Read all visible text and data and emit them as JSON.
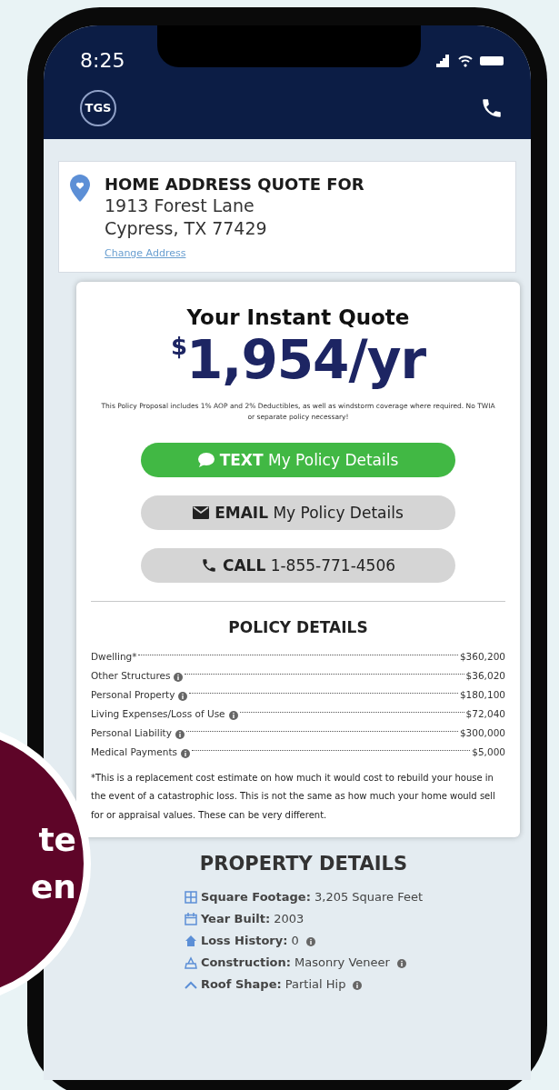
{
  "status_bar": {
    "time": "8:25"
  },
  "header": {
    "logo": "TGS"
  },
  "address_card": {
    "heading": "HOME ADDRESS QUOTE FOR",
    "line_1": "1913 Forest Lane",
    "line_2": "Cypress, TX 77429",
    "change_link": "Change Address"
  },
  "quote": {
    "title": "Your Instant Quote",
    "currency": "$",
    "amount": "1,954/yr",
    "disclaimer": "This Policy Proposal includes 1% AOP and 2% Deductibles, as well as windstorm coverage where required. No TWIA or separate policy necessary!",
    "buttons": [
      {
        "kind": "text",
        "label": "**TEXT** My Policy Details"
      },
      {
        "kind": "email",
        "label": "**EMAIL** My Policy Details"
      },
      {
        "kind": "call",
        "label": "**CALL** 1-855-771-4506"
      }
    ]
  },
  "policy_details": {
    "title": "POLICY DETAILS",
    "rows": [
      {
        "label": "Dwelling*",
        "info": false,
        "value": "$360,200"
      },
      {
        "label": "Other Structures",
        "info": true,
        "value": "$36,020"
      },
      {
        "label": "Personal Property",
        "info": true,
        "value": "$180,100"
      },
      {
        "label": "Living Expenses/Loss of Use",
        "info": true,
        "value": "$72,040"
      },
      {
        "label": "Personal Liability",
        "info": true,
        "value": "$300,000"
      },
      {
        "label": "Medical Payments",
        "info": true,
        "value": "$5,000"
      }
    ],
    "note": "*This is a replacement cost estimate on how much it would cost to rebuild your house in the event of a catastrophic loss. This is not the same as how much your home would sell for or appraisal values. These can be very different."
  },
  "property_details": {
    "title": "PROPERTY DETAILS",
    "items": [
      {
        "kind": "area",
        "label": "Square Footage:",
        "value": "3,205 Square Feet",
        "info": false
      },
      {
        "kind": "year",
        "label": "Year Built:",
        "value": "2003",
        "info": false
      },
      {
        "kind": "loss",
        "label": "Loss History:",
        "value": "0",
        "info": true
      },
      {
        "kind": "construction",
        "label": "Construction:",
        "value": "Masonry Veneer",
        "info": true
      },
      {
        "kind": "roof",
        "label": "Roof Shape:",
        "value": "Partial Hip",
        "info": true
      }
    ]
  },
  "badge": {
    "lines": [
      "te",
      "en"
    ]
  }
}
